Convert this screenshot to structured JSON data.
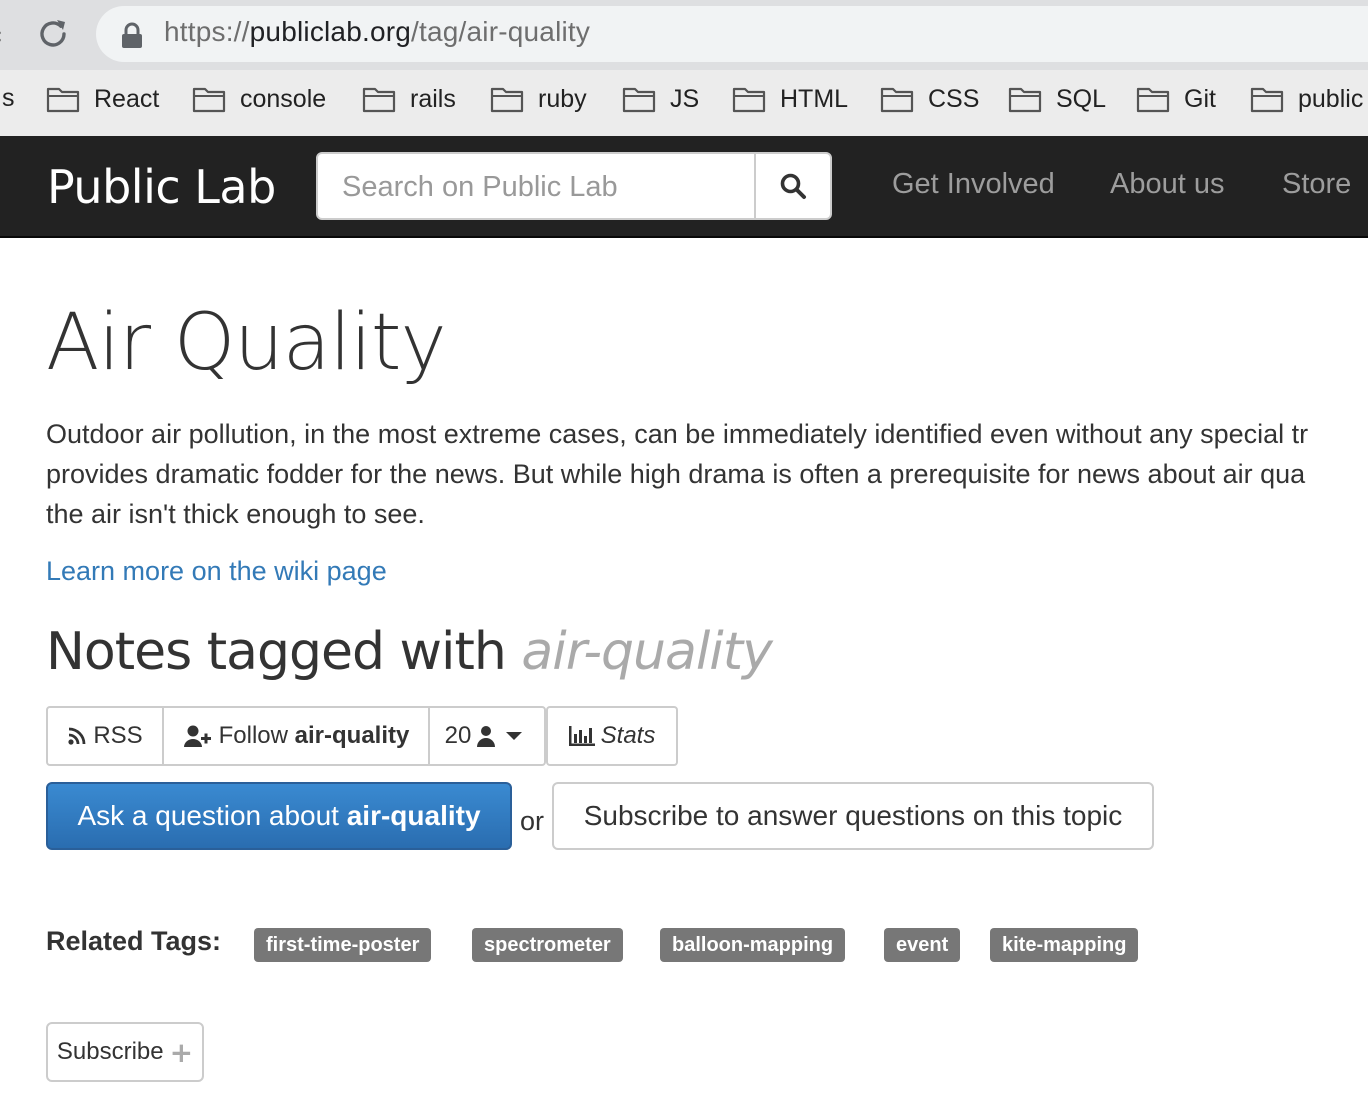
{
  "browser": {
    "url_scheme": "https://",
    "url_domain": "publiclab.org",
    "url_path": "/tag/air-quality",
    "bookmark_cut": "s",
    "bookmarks": [
      "React",
      "console",
      "rails",
      "ruby",
      "JS",
      "HTML",
      "CSS",
      "SQL",
      "Git",
      "public"
    ]
  },
  "navbar": {
    "brand": "Public Lab",
    "search_placeholder": "Search on Public Lab",
    "links": [
      "Get Involved",
      "About us",
      "Store"
    ]
  },
  "page": {
    "title": "Air Quality",
    "description_lines": [
      "Outdoor air pollution, in the most extreme cases, can be immediately identified even without any special tr",
      "provides dramatic fodder for the news. But while high drama is often a prerequisite for news about air qua",
      "the air isn't thick enough to see."
    ],
    "wiki_link": "Learn more on the wiki page",
    "notes_heading_prefix": "Notes tagged with ",
    "notes_heading_tag": "air-quality"
  },
  "actions": {
    "rss": "RSS",
    "follow_prefix": "Follow ",
    "follow_tag": "air-quality",
    "followers_count": "20",
    "stats": "Stats",
    "ask_prefix": "Ask a question about ",
    "ask_tag": "air-quality",
    "or": "or",
    "subscribe_answer": "Subscribe to answer questions on this topic"
  },
  "related": {
    "label": "Related Tags:",
    "tags": [
      "first-time-poster",
      "spectrometer",
      "balloon-mapping",
      "event",
      "kite-mapping"
    ]
  },
  "subscribe": {
    "label": "Subscribe"
  },
  "colors": {
    "navbar_bg": "#222222",
    "link": "#337ab7",
    "primary_button": "#337ab7",
    "tag_badge": "#777777"
  }
}
